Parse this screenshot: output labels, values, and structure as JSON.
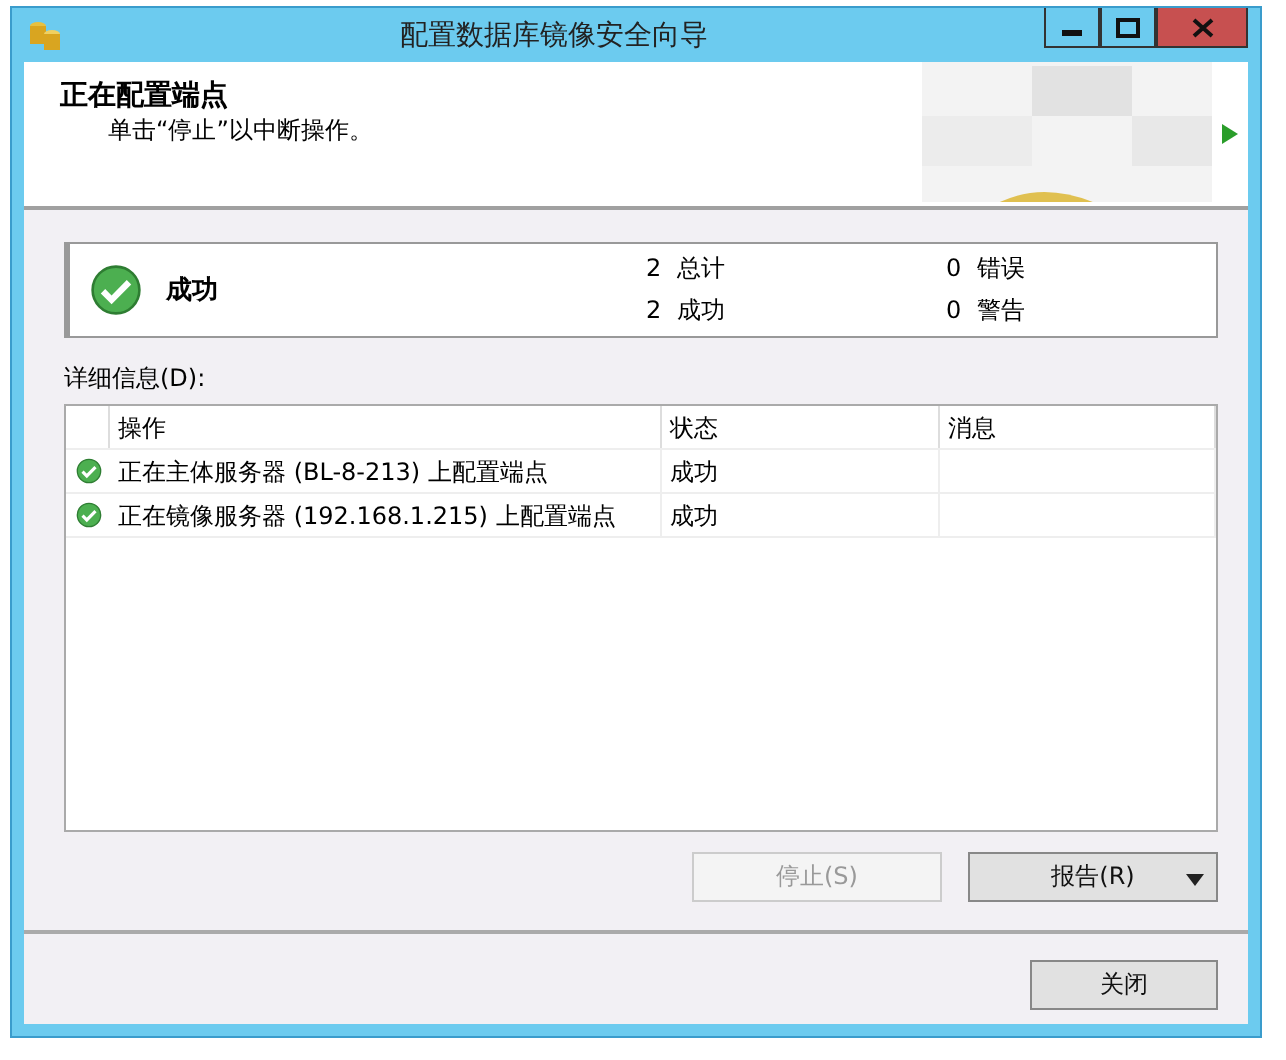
{
  "window": {
    "title": "配置数据库镜像安全向导"
  },
  "header": {
    "title": "正在配置端点",
    "subtitle": "单击“停止”以中断操作。"
  },
  "summary": {
    "status": "成功",
    "stats": [
      {
        "count": "2",
        "label": "总计"
      },
      {
        "count": "0",
        "label": "错误"
      },
      {
        "count": "2",
        "label": "成功"
      },
      {
        "count": "0",
        "label": "警告"
      }
    ]
  },
  "details_label": "详细信息(D):",
  "table": {
    "columns": [
      "操作",
      "状态",
      "消息"
    ],
    "rows": [
      {
        "action": "正在主体服务器 (BL-8-213) 上配置端点",
        "status": "成功",
        "message": ""
      },
      {
        "action": "正在镜像服务器 (192.168.1.215) 上配置端点",
        "status": "成功",
        "message": ""
      }
    ]
  },
  "buttons": [
    {
      "label": "停止(S)",
      "disabled": true
    },
    {
      "label": "报告(R)",
      "disabled": false
    }
  ],
  "close_button": "关闭"
}
